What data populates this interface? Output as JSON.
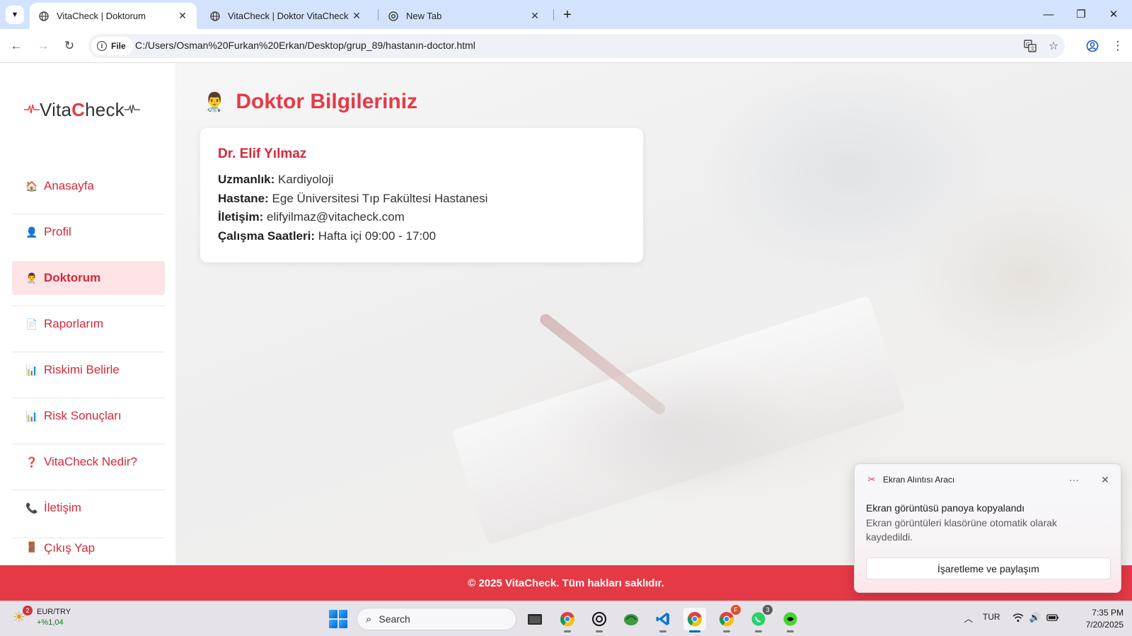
{
  "browser": {
    "tabs": [
      {
        "title": "VitaCheck | Doktorum",
        "active": true
      },
      {
        "title": "VitaCheck | Doktor VitaCheck N",
        "active": false
      },
      {
        "title": "New Tab",
        "active": false
      }
    ],
    "site_chip_label": "File",
    "url": "C:/Users/Osman%20Furkan%20Erkan/Desktop/grup_89/hastanın-doctor.html"
  },
  "sidebar": {
    "logo": {
      "prefix": "Vita",
      "c": "C",
      "suffix": "heck"
    },
    "items": [
      {
        "label": "Anasayfa",
        "icon": "house-icon",
        "glyph": "🏠",
        "active": false
      },
      {
        "label": "Profil",
        "icon": "person-icon",
        "glyph": "👤",
        "active": false
      },
      {
        "label": "Doktorum",
        "icon": "doctor-icon",
        "glyph": "👨‍⚕️",
        "active": true
      },
      {
        "label": "Raporlarım",
        "icon": "document-icon",
        "glyph": "📄",
        "active": false
      },
      {
        "label": "Riskimi Belirle",
        "icon": "bar-chart-icon",
        "glyph": "📊",
        "active": false
      },
      {
        "label": "Risk Sonuçları",
        "icon": "bar-chart-icon",
        "glyph": "📊",
        "active": false
      },
      {
        "label": "VitaCheck Nedir?",
        "icon": "question-icon",
        "glyph": "❓",
        "active": false
      },
      {
        "label": "İletişim",
        "icon": "phone-icon",
        "glyph": "📞",
        "active": false
      },
      {
        "label": "Çıkış Yap",
        "icon": "door-icon",
        "glyph": "🚪",
        "active": false
      }
    ]
  },
  "main": {
    "title": "Doktor Bilgileriniz",
    "title_icon": "doctor-icon",
    "doctor": {
      "name": "Dr. Elif Yılmaz",
      "fields": [
        {
          "label": "Uzmanlık:",
          "value": "Kardiyoloji"
        },
        {
          "label": "Hastane:",
          "value": "Ege Üniversitesi Tıp Fakültesi Hastanesi"
        },
        {
          "label": "İletişim:",
          "value": "elifyilmaz@vitacheck.com"
        },
        {
          "label": "Çalışma Saatleri:",
          "value": "Hafta içi 09:00 - 17:00"
        }
      ]
    }
  },
  "footer": {
    "text": "© 2025 VitaCheck. Tüm hakları saklıdır."
  },
  "notification": {
    "app_name": "Ekran Alıntısı Aracı",
    "more_label": "···",
    "title": "Ekran görüntüsü panoya kopyalandı",
    "body": "Ekran görüntüleri klasörüne otomatik olarak kaydedildi.",
    "action_label": "İşaretleme ve paylaşım"
  },
  "taskbar": {
    "widget": {
      "badge": "2",
      "symbol": "EUR/TRY",
      "change": "+%1,04"
    },
    "search_placeholder": "Search",
    "apps": [
      {
        "name": "file-explorer-icon"
      },
      {
        "name": "chrome-icon"
      },
      {
        "name": "chatgpt-icon"
      },
      {
        "name": "app-green-icon"
      },
      {
        "name": "vscode-icon"
      },
      {
        "name": "chrome-icon",
        "active": true
      },
      {
        "name": "chrome-profile-icon",
        "badge": "F"
      },
      {
        "name": "whatsapp-icon",
        "badge": "3"
      },
      {
        "name": "razer-icon"
      }
    ],
    "tray": {
      "language": "TUR"
    },
    "clock": {
      "time": "7:35 PM",
      "date": "7/20/2025"
    }
  },
  "colors": {
    "brand": "#e63946",
    "active_nav_bg": "#fde3e5"
  }
}
